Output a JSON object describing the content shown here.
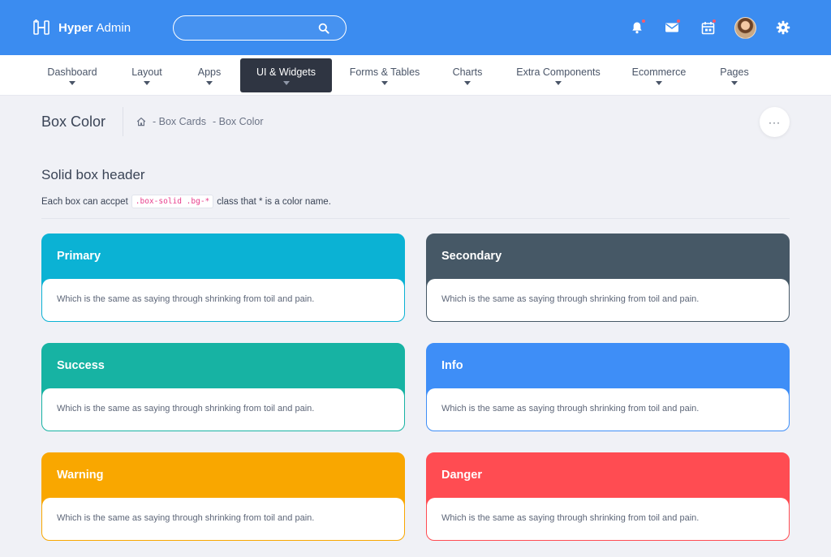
{
  "app": {
    "brand_bold": "Hyper",
    "brand_light": "Admin"
  },
  "search": {
    "placeholder": "",
    "value": ""
  },
  "topbar": {
    "icons": [
      "bell-icon",
      "mail-icon",
      "calendar-icon",
      "avatar",
      "gear-icon"
    ]
  },
  "nav": {
    "items": [
      {
        "label": "Dashboard"
      },
      {
        "label": "Layout"
      },
      {
        "label": "Apps"
      },
      {
        "label": "UI & Widgets",
        "active": true
      },
      {
        "label": "Forms & Tables"
      },
      {
        "label": "Charts"
      },
      {
        "label": "Extra Components"
      },
      {
        "label": "Ecommerce"
      },
      {
        "label": "Pages"
      }
    ]
  },
  "page": {
    "title": "Box Color",
    "breadcrumb": [
      "- Box Cards",
      "- Box Color"
    ],
    "more_label": "···"
  },
  "section": {
    "title": "Solid box header",
    "desc_before": "Each box can accpet",
    "desc_code": ".box-solid .bg-*",
    "desc_after": "class that * is a color name."
  },
  "boxes": [
    {
      "title": "Primary",
      "body": "Which is the same as saying through shrinking from toil and pain.",
      "color": "#0bb2d4"
    },
    {
      "title": "Secondary",
      "body": "Which is the same as saying through shrinking from toil and pain.",
      "color": "#465866"
    },
    {
      "title": "Success",
      "body": "Which is the same as saying through shrinking from toil and pain.",
      "color": "#17b3a3"
    },
    {
      "title": "Info",
      "body": "Which is the same as saying through shrinking from toil and pain.",
      "color": "#3e8ef7"
    },
    {
      "title": "Warning",
      "body": "Which is the same as saying through shrinking from toil and pain.",
      "color": "#f9a700"
    },
    {
      "title": "Danger",
      "body": "Which is the same as saying through shrinking from toil and pain.",
      "color": "#ff4c52"
    }
  ],
  "colors": {
    "topbar": "#3b8cf0",
    "nav_active": "#2f3542",
    "code_text": "#e83e8c"
  }
}
